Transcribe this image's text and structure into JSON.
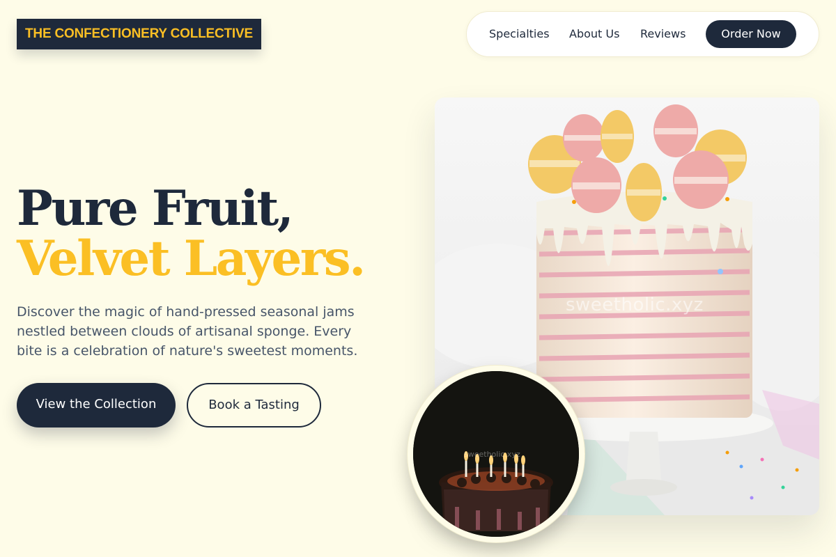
{
  "header": {
    "brand": "THE CONFECTIONERY COLLECTIVE",
    "nav": {
      "specialties": "Specialties",
      "about": "About Us",
      "reviews": "Reviews",
      "cta": "Order Now"
    }
  },
  "hero": {
    "headline_line1": "Pure Fruit,",
    "headline_line2": "Velvet Layers.",
    "description": "Discover the magic of hand-pressed seasonal jams nestled between clouds of artisanal sponge. Every bite is a celebration of nature's sweetest moments.",
    "primary_button": "View the Collection",
    "secondary_button": "Book a Tasting",
    "main_image_watermark": "sweetholic.xyz",
    "circle_image_watermark": "sweetholic.xyz"
  },
  "colors": {
    "background": "#fefce8",
    "navy": "#1e293b",
    "accent_gold": "#fbbf24",
    "body_text": "#475569"
  }
}
